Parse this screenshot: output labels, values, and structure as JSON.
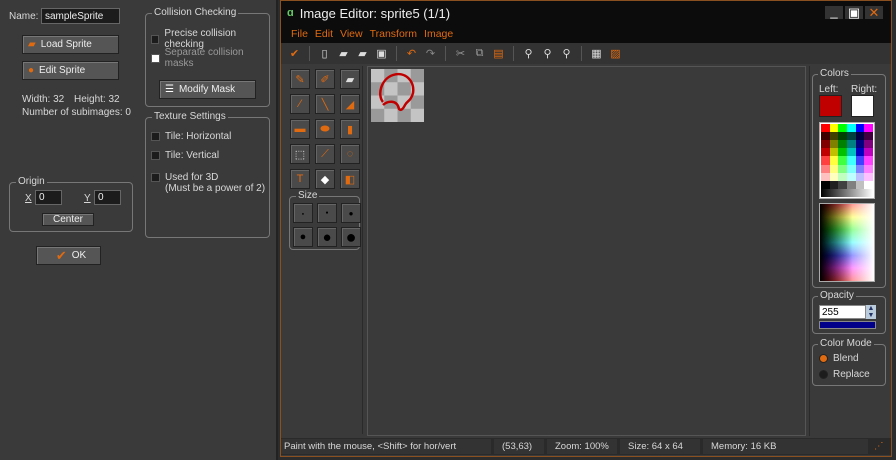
{
  "sprite": {
    "name_label": "Name:",
    "name_value": "sampleSprite",
    "load_label": "Load Sprite",
    "edit_label": "Edit Sprite",
    "width_text": "Width: 32",
    "height_text": "Height: 32",
    "subimages_text": "Number of subimages: 0",
    "origin": {
      "title": "Origin",
      "x_label": "X",
      "x_value": "0",
      "y_label": "Y",
      "y_value": "0",
      "center_label": "Center"
    },
    "ok_label": "OK",
    "collision": {
      "title": "Collision Checking",
      "precise": "Precise collision checking",
      "separate": "Separate collision masks",
      "modify": "Modify Mask"
    },
    "texture": {
      "title": "Texture Settings",
      "tile_h": "Tile: Horizontal",
      "tile_v": "Tile: Vertical",
      "used3d": "Used for 3D",
      "used3d_note": "(Must be a power of 2)"
    }
  },
  "editor": {
    "title": "Image Editor: sprite5 (1/1)",
    "menu": [
      "File",
      "Edit",
      "View",
      "Transform",
      "Image"
    ],
    "size_label": "Size",
    "colors": {
      "title": "Colors",
      "left_label": "Left:",
      "right_label": "Right:",
      "left_color": "#c00000",
      "right_color": "#ffffff",
      "palette": [
        [
          "#ff0000",
          "#ffff00",
          "#00ff00",
          "#00ffff",
          "#0000ff",
          "#ff00ff"
        ],
        [
          "#400000",
          "#404000",
          "#004000",
          "#004040",
          "#000040",
          "#400040"
        ],
        [
          "#800000",
          "#808000",
          "#008000",
          "#008080",
          "#000080",
          "#800080"
        ],
        [
          "#c00000",
          "#c0c000",
          "#00c000",
          "#00c0c0",
          "#0000c0",
          "#c000c0"
        ],
        [
          "#ff4040",
          "#ffff40",
          "#40ff40",
          "#40ffff",
          "#4040ff",
          "#ff40ff"
        ],
        [
          "#ff8080",
          "#ffff80",
          "#80ff80",
          "#80ffff",
          "#8080ff",
          "#ff80ff"
        ],
        [
          "#ffc0c0",
          "#ffffc0",
          "#c0ffc0",
          "#c0ffff",
          "#c0c0ff",
          "#ffc0ff"
        ],
        [
          "#000000",
          "#202020",
          "#404040",
          "#808080",
          "#c0c0c0",
          "#ffffff"
        ]
      ]
    },
    "opacity": {
      "title": "Opacity",
      "value": "255",
      "fraction": 1.0
    },
    "color_mode": {
      "title": "Color Mode",
      "blend": "Blend",
      "replace": "Replace",
      "selected": "Blend"
    },
    "status": {
      "hint": "Paint with the mouse, <Shift> for hor/vert",
      "coords": "(53,63)",
      "zoom": "Zoom: 100%",
      "size": "Size: 64 x 64",
      "memory": "Memory: 16 KB"
    }
  }
}
